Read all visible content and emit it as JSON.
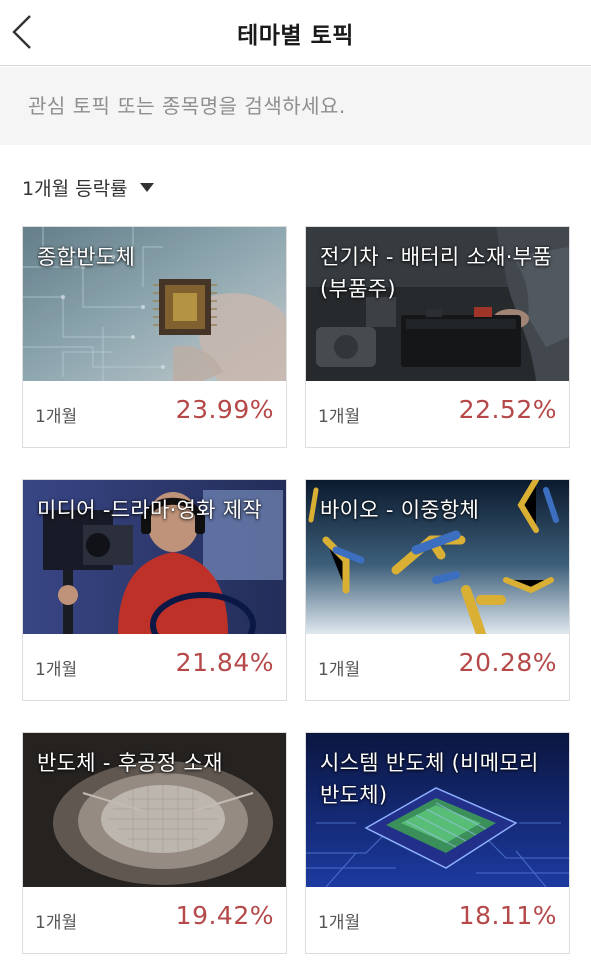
{
  "header": {
    "title": "테마별 토픽",
    "back_icon": "chevron-left-icon"
  },
  "search": {
    "placeholder": "관심 토픽 또는 종목명을 검색하세요.",
    "value": ""
  },
  "sort": {
    "label": "1개월 등락률",
    "icon": "triangle-down-icon"
  },
  "colors": {
    "rate": "#b54848",
    "title_text": "#ffffff"
  },
  "topics": [
    {
      "title": "종합반도체",
      "period": "1개월",
      "rate": "23.99%"
    },
    {
      "title": "전기차 - 배터리 소재·부품(부품주)",
      "period": "1개월",
      "rate": "22.52%"
    },
    {
      "title": "미디어 -드라마·영화 제작",
      "period": "1개월",
      "rate": "21.84%"
    },
    {
      "title": "바이오 - 이중항체",
      "period": "1개월",
      "rate": "20.28%"
    },
    {
      "title": "반도체 - 후공정 소재",
      "period": "1개월",
      "rate": "19.42%"
    },
    {
      "title": "시스템 반도체 (비메모리 반도체)",
      "period": "1개월",
      "rate": "18.11%"
    }
  ]
}
